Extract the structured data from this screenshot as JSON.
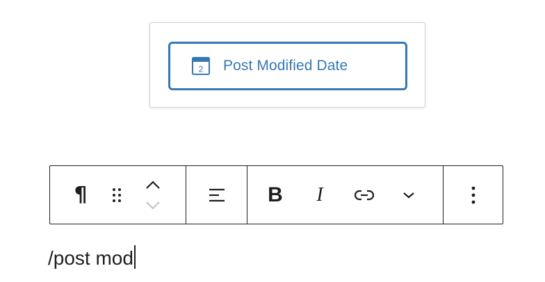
{
  "autocomplete": {
    "suggestion": {
      "icon": "calendar-icon",
      "icon_number": "2",
      "label": "Post Modified Date",
      "accent_color": "#3578b3"
    }
  },
  "block_toolbar": {
    "block_type_icon": "paragraph-icon",
    "block_type_glyph": "¶",
    "drag_icon": "drag-handle-icon",
    "move_up_icon": "chevron-up-icon",
    "move_down_icon": "chevron-down-icon",
    "align_icon": "align-left-icon",
    "bold_label": "B",
    "italic_label": "I",
    "link_icon": "link-icon",
    "more_formatting_icon": "chevron-down-icon",
    "options_icon": "more-vertical-icon"
  },
  "editor": {
    "paragraph_text": "/post mod"
  }
}
